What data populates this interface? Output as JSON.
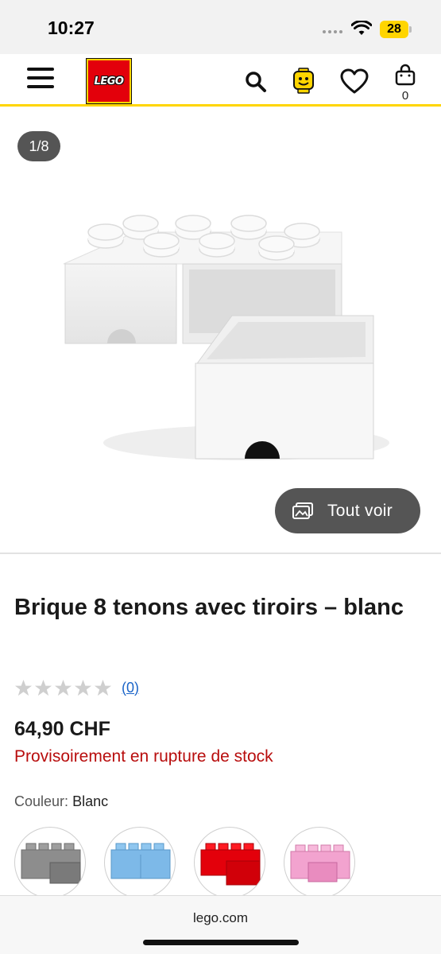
{
  "status_bar": {
    "time": "10:27",
    "battery": "28"
  },
  "header": {
    "logo_text": "LEGO",
    "cart_count": "0"
  },
  "gallery": {
    "counter": "1/8",
    "view_all_label": "Tout voir"
  },
  "product": {
    "title": "Brique 8 tenons avec tiroirs – blanc",
    "rating": {
      "stars": 0,
      "max_stars": 5,
      "count_label": "(0)"
    },
    "price": "64,90 CHF",
    "stock_status": "Provisoirement en rupture de stock",
    "color": {
      "label": "Couleur:",
      "value": "Blanc"
    },
    "swatches": [
      {
        "color": "#8d8d8d",
        "name": "grey"
      },
      {
        "color": "#7db9e8",
        "name": "light-blue"
      },
      {
        "color": "#e3000b",
        "name": "red"
      },
      {
        "color": "#f2a3cf",
        "name": "pink"
      }
    ]
  },
  "browser": {
    "url": "lego.com"
  },
  "colors": {
    "accent": "#ffd500",
    "brand_red": "#e3000b",
    "stock_red": "#b80d0d",
    "link_blue": "#1a64c8"
  }
}
